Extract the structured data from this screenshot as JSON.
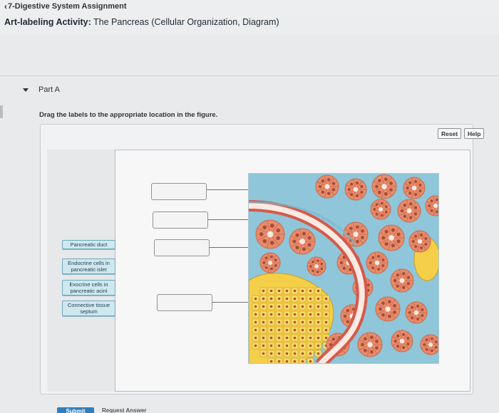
{
  "header": {
    "back_label": "7-Digestive System Assignment",
    "title_prefix": "Art-labeling Activity:",
    "title_rest": "The Pancreas (Cellular Organization, Diagram)"
  },
  "part": {
    "label": "Part A"
  },
  "instructions": "Drag the labels to the appropriate location in the figure.",
  "controls": {
    "reset_label": "Reset",
    "help_label": "Help"
  },
  "labels": [
    {
      "text": "Pancreatic duct"
    },
    {
      "text": "Endocrine cells in pancreatic islet"
    },
    {
      "text": "Exocrine cells in pancreatic acini"
    },
    {
      "text": "Connective tissue septum"
    }
  ],
  "footer": {
    "submit_label": "Submit",
    "request_label": "Request Answer"
  },
  "colors": {
    "chip_fill": "#cfe7ef",
    "chip_border": "#6fa8bd",
    "acinus": "#e88b6a",
    "acinus_cell": "#f4b19a",
    "islet": "#f5cf48",
    "septum": "#8fc6d9",
    "duct_wall": "#d45a4a",
    "lumen": "#fbe9e2"
  }
}
